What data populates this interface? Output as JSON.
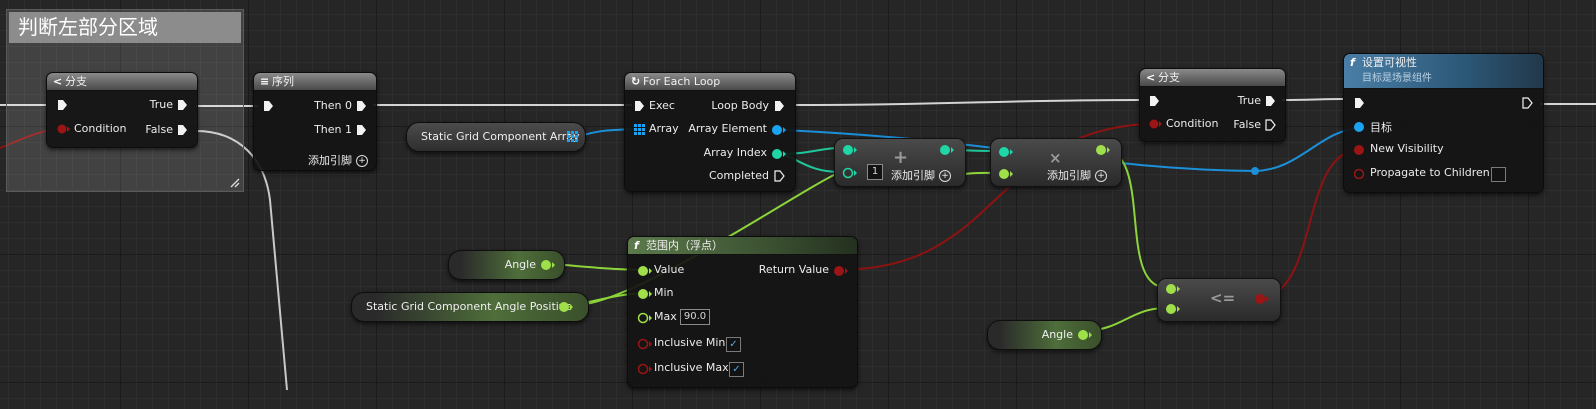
{
  "comment": {
    "title": "判断左部分区域"
  },
  "branch1": {
    "title": "分支",
    "exec_true": "True",
    "exec_false": "False",
    "condition": "Condition"
  },
  "sequence": {
    "title": "序列",
    "then0": "Then 0",
    "then1": "Then 1",
    "add_pin": "添加引脚"
  },
  "var_array": {
    "label": "Static Grid Component Array"
  },
  "foreach": {
    "title": "For Each Loop",
    "exec": "Exec",
    "array": "Array",
    "loop_body": "Loop Body",
    "array_element": "Array Element",
    "array_index": "Array Index",
    "completed": "Completed"
  },
  "add_node": {
    "symbol": "+",
    "value": "1",
    "add_pin": "添加引脚"
  },
  "mul_node": {
    "symbol": "×",
    "add_pin": "添加引脚"
  },
  "branch2": {
    "title": "分支",
    "exec_true": "True",
    "exec_false": "False",
    "condition": "Condition"
  },
  "set_visibility": {
    "title": "设置可视性",
    "subtitle": "目标是场景组件",
    "target": "目标",
    "new_visibility": "New Visibility",
    "propagate": "Propagate to Children",
    "propagate_checked": false
  },
  "in_range": {
    "title": "范围内（浮点）",
    "value": "Value",
    "min": "Min",
    "max": "Max",
    "max_value": "90.0",
    "inclusive_min": "Inclusive Min",
    "inclusive_max": "Inclusive Max",
    "return_value": "Return Value",
    "inclusive_min_checked": true,
    "inclusive_max_checked": true
  },
  "var_angle1": {
    "label": "Angle"
  },
  "var_angle_positive": {
    "label": "Static Grid Component Angle Positive"
  },
  "compare": {
    "symbol": "<="
  },
  "var_angle2": {
    "label": "Angle"
  },
  "colors": {
    "exec": "#f2f2f2",
    "bool": "#9b1515",
    "float": "#9fe04a",
    "int": "#1fd6a6",
    "object": "#1aa3f0"
  }
}
